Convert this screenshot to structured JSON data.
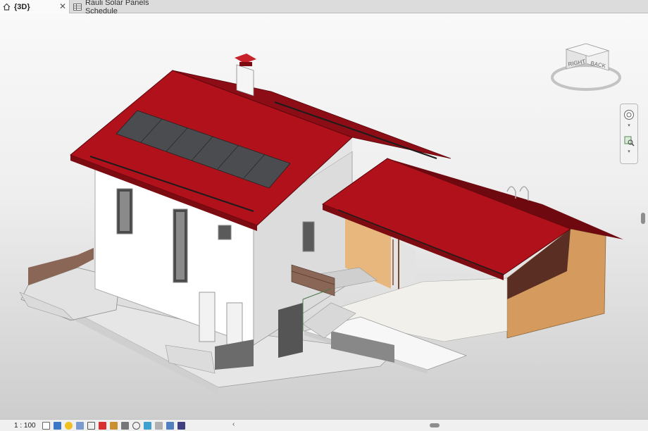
{
  "tabs": [
    {
      "label": "{3D}",
      "icon": "home-icon",
      "active": true
    },
    {
      "label": "Rauli Solar Panels Schedule",
      "icon": "schedule-table-icon",
      "active": false
    }
  ],
  "viewcube": {
    "face_right": "RIGHT",
    "face_back": "BACK"
  },
  "status": {
    "scale": "1 : 100"
  },
  "view_control_icons": [
    "detail-level-icon",
    "visual-style-icon",
    "sun-path-icon",
    "shadows-icon",
    "crop-view-icon",
    "show-crop-region-icon",
    "unlock-3d-view-icon",
    "temporary-hide-icon",
    "reveal-hidden-icon",
    "temporary-view-properties-icon",
    "show-analytical-model-icon",
    "highlight-displacement-icon",
    "constraints-icon"
  ],
  "colors": {
    "roof": "#b0111b",
    "roof_dark": "#6e0a0f",
    "wall": "#ffffff",
    "wall_side": "#d9d9d9",
    "interior_warm": "#e8b77e",
    "solar_panel": "#4a4c50",
    "slab": "#f5f5f5"
  }
}
